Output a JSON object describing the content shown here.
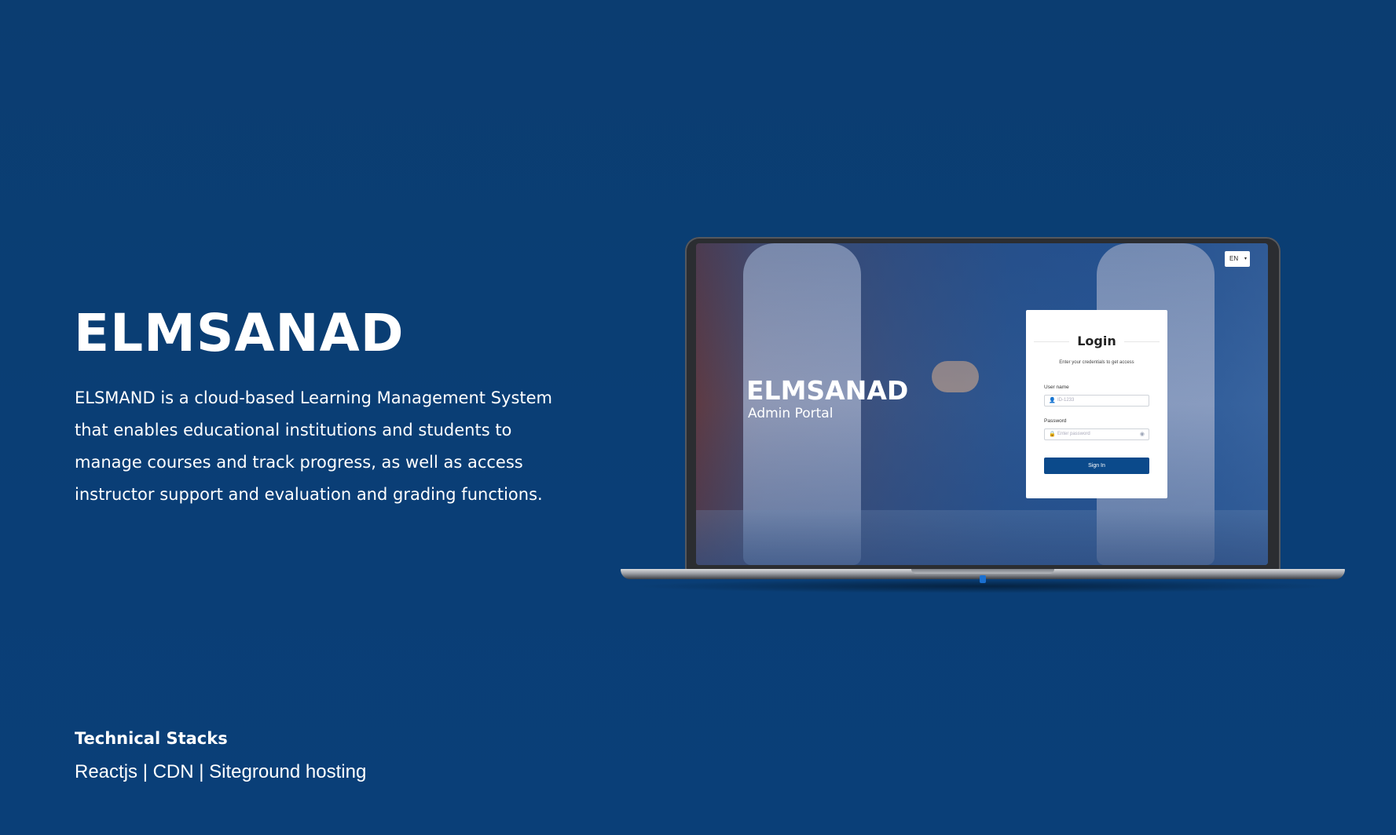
{
  "brand": {
    "logo": "ELMSANAD"
  },
  "description": "ELSMAND is a cloud-based Learning Management System that enables educational institutions and students to manage courses and track progress, as well as access instructor support and evaluation and grading functions.",
  "technical": {
    "title": "Technical Stacks",
    "stacks": "Reactjs | CDN | Siteground hosting"
  },
  "mockup": {
    "logo": "ELMSANAD",
    "subtitle": "Admin Portal",
    "language": "EN",
    "login": {
      "title": "Login",
      "subtitle": "Enter your credentials to get access",
      "username_label": "User name",
      "username_placeholder": "ID-1233",
      "password_label": "Password",
      "password_placeholder": "Enter password",
      "signin_label": "Sign In"
    }
  },
  "colors": {
    "background": "#0b3d71",
    "button": "#0b4a8b",
    "text": "#ffffff"
  }
}
